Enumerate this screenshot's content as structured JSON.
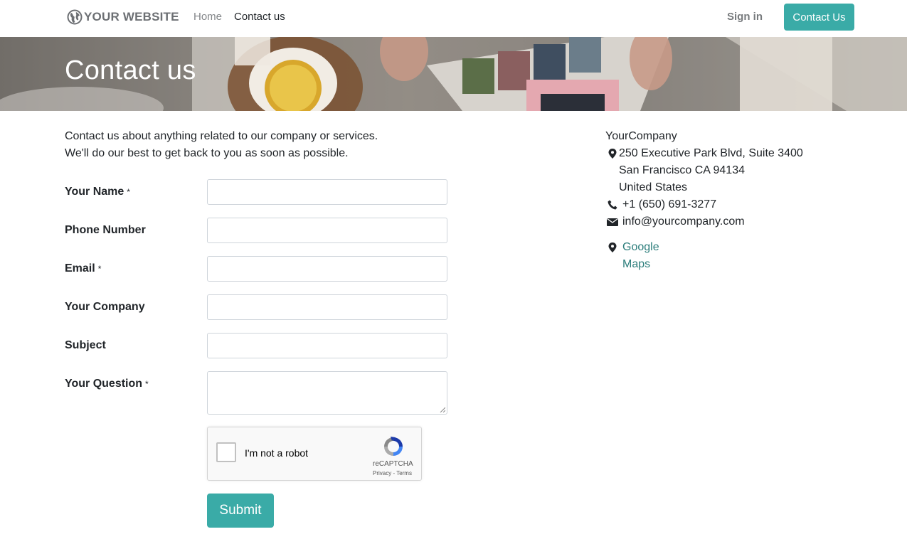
{
  "header": {
    "logo_text": "YOUR WEBSITE",
    "nav": [
      "Home",
      "Contact us"
    ],
    "sign_in": "Sign in",
    "cta": "Contact Us"
  },
  "banner": {
    "title": "Contact us"
  },
  "intro": {
    "line1": "Contact us about anything related to our company or services.",
    "line2": "We'll do our best to get back to you as soon as possible."
  },
  "form": {
    "fields": [
      {
        "label": "Your Name",
        "required": "*",
        "value": ""
      },
      {
        "label": "Phone Number",
        "required": "",
        "value": ""
      },
      {
        "label": "Email",
        "required": "*",
        "value": ""
      },
      {
        "label": "Your Company",
        "required": "",
        "value": ""
      },
      {
        "label": "Subject",
        "required": "",
        "value": ""
      },
      {
        "label": "Your Question",
        "required": "*",
        "value": ""
      }
    ],
    "captcha": {
      "text": "I'm not a robot",
      "brand": "reCAPTCHA",
      "links": "Privacy - Terms"
    },
    "submit": "Submit"
  },
  "address": {
    "company": "YourCompany",
    "street": "250 Executive Park Blvd, Suite 3400",
    "city": "San Francisco CA 94134",
    "country": "United States",
    "phone": "+1 (650) 691-3277",
    "email": "info@yourcompany.com",
    "maps": "Google Maps"
  },
  "colors": {
    "accent": "#3aaba7",
    "link": "#2b7d7b"
  },
  "icons": [
    "globe-icon",
    "map-marker-icon",
    "phone-icon",
    "envelope-icon",
    "recaptcha-icon"
  ]
}
